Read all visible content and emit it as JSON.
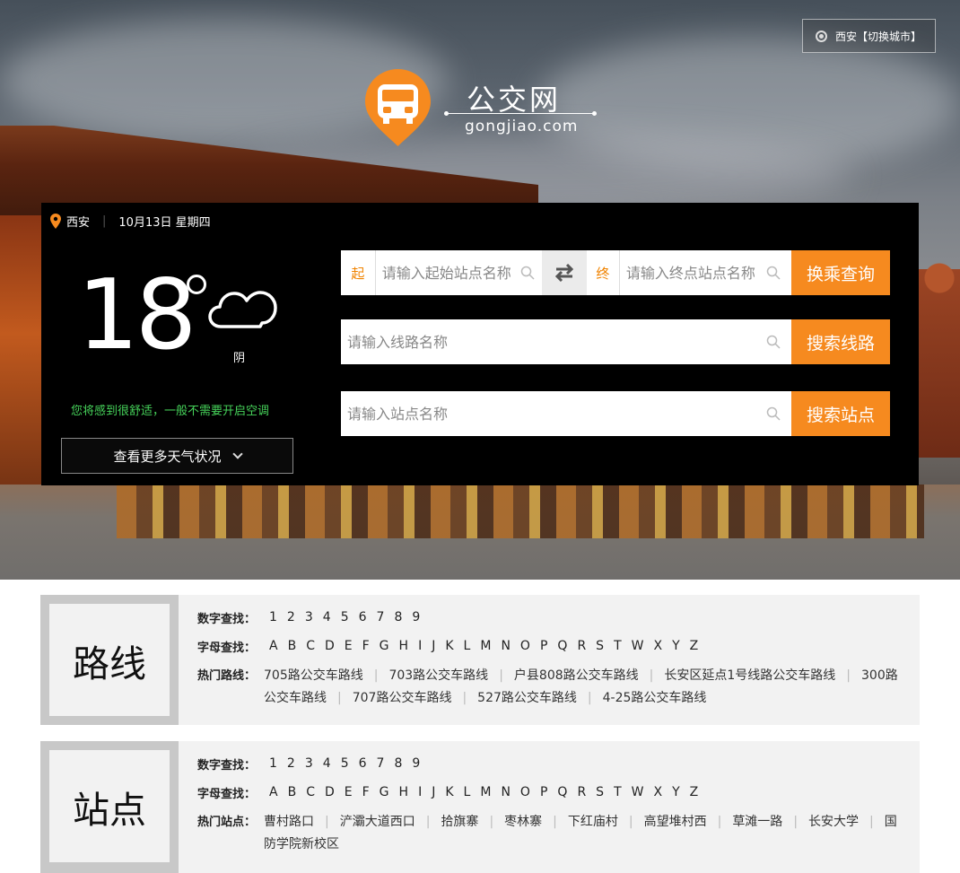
{
  "header": {
    "city_switch": "西安【切换城市】",
    "logo_title": "公交网",
    "logo_sub": "gongjiao.com"
  },
  "panel": {
    "city": "西安",
    "date": "10月13日 星期四",
    "temperature": "18",
    "weather": "阴",
    "advice": "您将感到很舒适，一般不需要开启空调",
    "more_weather": "查看更多天气状况"
  },
  "search": {
    "start_tag": "起",
    "start_placeholder": "请输入起始站点名称",
    "end_tag": "终",
    "end_placeholder": "请输入终点站点名称",
    "transfer_button": "换乘查询",
    "line_placeholder": "请输入线路名称",
    "line_button": "搜索线路",
    "stop_placeholder": "请输入站点名称",
    "stop_button": "搜索站点"
  },
  "routes": {
    "title": "路线",
    "digit_label": "数字查找：",
    "letter_label": "字母查找：",
    "hot_label": "热门路线：",
    "hot_items": [
      "705路公交车路线",
      "703路公交车路线",
      "户县808路公交车路线",
      "长安区延点1号线路公交车路线",
      "300路公交车路线",
      "707路公交车路线",
      "527路公交车路线",
      "4-25路公交车路线"
    ]
  },
  "stops": {
    "title": "站点",
    "digit_label": "数字查找：",
    "letter_label": "字母查找：",
    "hot_label": "热门站点：",
    "hot_items": [
      "曹村路口",
      "浐灞大道西口",
      "拾旗寨",
      "枣林寨",
      "下红庙村",
      "高望堆村西",
      "草滩一路",
      "长安大学",
      "国防学院新校区"
    ]
  },
  "digits": [
    "1",
    "2",
    "3",
    "4",
    "5",
    "6",
    "7",
    "8",
    "9"
  ],
  "letters": [
    "A",
    "B",
    "C",
    "D",
    "E",
    "F",
    "G",
    "H",
    "I",
    "J",
    "K",
    "L",
    "M",
    "N",
    "O",
    "P",
    "Q",
    "R",
    "S",
    "T",
    "W",
    "X",
    "Y",
    "Z"
  ],
  "colors": {
    "accent": "#f68a1f",
    "advice": "#46d35a",
    "panel": "#000000"
  },
  "icons": [
    "location-pin-icon",
    "bus-logo-icon",
    "cloud-icon",
    "swap-icon",
    "search-icon",
    "chevron-down-icon"
  ]
}
